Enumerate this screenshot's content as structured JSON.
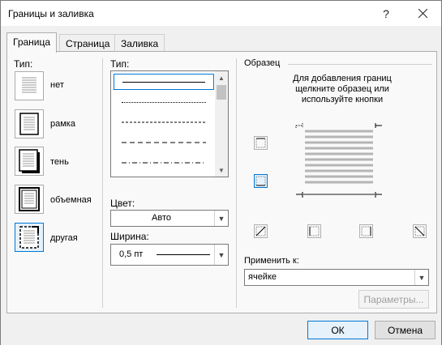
{
  "window": {
    "title": "Границы и заливка"
  },
  "tabs": [
    {
      "label": "Граница",
      "active": true
    },
    {
      "label": "Страница",
      "active": false
    },
    {
      "label": "Заливка",
      "active": false
    }
  ],
  "settings": {
    "header": "Тип:",
    "items": [
      {
        "label": "нет"
      },
      {
        "label": "рамка"
      },
      {
        "label": "тень"
      },
      {
        "label": "объемная"
      },
      {
        "label": "другая",
        "selected": true
      }
    ]
  },
  "style": {
    "header": "Тип:",
    "line_styles": [
      "solid",
      "dotted",
      "dashed-small",
      "dashed-large",
      "dash-dot"
    ],
    "color_label": "Цвет:",
    "color_value": "Авто",
    "width_label": "Ширина:",
    "width_value": "0,5 пт"
  },
  "preview": {
    "header": "Образец",
    "hint_line1": "Для добавления границ",
    "hint_line2": "щелкните образец или",
    "hint_line3": "используйте кнопки",
    "apply_to_label": "Применить к:",
    "apply_to_value": "ячейке",
    "options_button": "Параметры..."
  },
  "buttons": {
    "ok": "ОК",
    "cancel": "Отмена"
  },
  "colors": {
    "accent": "#0078d7",
    "dialog_bg": "#f0f0f0",
    "panel_bg": "#f9f9f9"
  }
}
